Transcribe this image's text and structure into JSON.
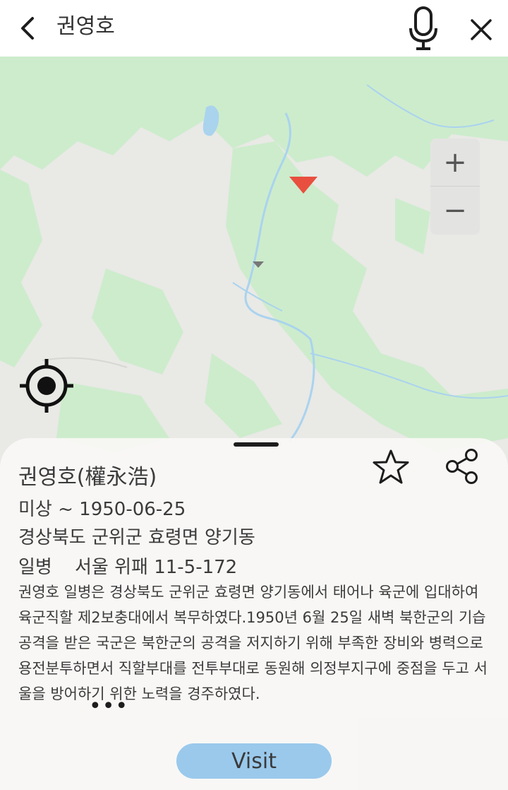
{
  "topbar": {
    "back_icon": "chevron-left-icon",
    "query": "권영호",
    "mic_icon": "microphone-icon",
    "close_icon": "close-icon"
  },
  "map": {
    "land_color": "#e9e9e6",
    "forest_color": "#cdeccc",
    "water_color": "#aad3ee",
    "marker_color": "#e94f3f",
    "zoom_in_label": "+",
    "zoom_out_label": "−",
    "locate_icon": "my-location-icon"
  },
  "detail": {
    "name": "권영호(權永浩)",
    "dates": "미상 ~ 1950-06-25",
    "hometown": "경상북도 군위군 효령면 양기동",
    "rank": "일병",
    "memorial": "서울 위패 11-5-172",
    "description": "권영호 일병은 경상북도 군위군 효령면 양기동에서 태어나 육군에 입대하여 육군직할 제2보충대에서 복무하였다.1950년 6월 25일 새벽 북한군의 기습공격을 받은 국군은 북한군의 공격을 저지하기 위해 부족한 장비와 병력으로 용전분투하면서 직할부대를 전투부대로 동원해 의정부지구에 중점을 두고 서울을 방어하기 위한 노력을 경주하였다.",
    "more": "•••",
    "star_icon": "star-outline-icon",
    "share_icon": "share-icon",
    "visit_label": "Visit",
    "visit_color": "#9ac9ec"
  }
}
